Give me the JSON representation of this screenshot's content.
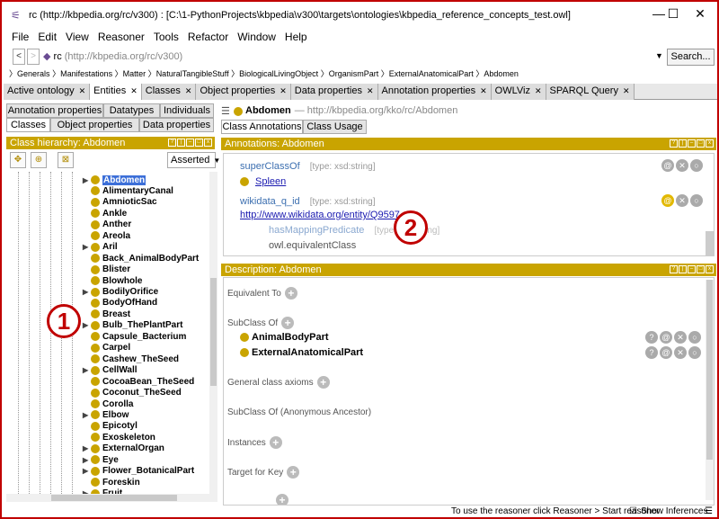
{
  "window": {
    "title": "rc (http://kbpedia.org/rc/v300)  : [C:\\1-PythonProjects\\kbpedia\\v300\\targets\\ontologies\\kbpedia_reference_concepts_test.owl]",
    "minimize": "—",
    "maximize": "☐",
    "close": "✕"
  },
  "menu": [
    "File",
    "Edit",
    "View",
    "Reasoner",
    "Tools",
    "Refactor",
    "Window",
    "Help"
  ],
  "address": {
    "back": "<",
    "forward": ">",
    "name": "rc",
    "uri": "(http://kbpedia.org/rc/v300)",
    "search_label": "Search..."
  },
  "breadcrumb": [
    "Generals",
    "Manifestations",
    "Matter",
    "NaturalTangibleStuff",
    "BiologicalLivingObject",
    "OrganismPart",
    "ExternalAnatomicalPart",
    "Abdomen"
  ],
  "tabs": [
    {
      "label": "Active ontology",
      "active": false
    },
    {
      "label": "Entities",
      "active": true
    },
    {
      "label": "Classes",
      "active": false
    },
    {
      "label": "Object properties",
      "active": false
    },
    {
      "label": "Data properties",
      "active": false
    },
    {
      "label": "Annotation properties",
      "active": false
    },
    {
      "label": "OWLViz",
      "active": false
    },
    {
      "label": "SPARQL Query",
      "active": false
    }
  ],
  "left": {
    "subtabs_row1": [
      "Annotation properties",
      "Datatypes",
      "Individuals"
    ],
    "subtabs_row2": [
      "Classes",
      "Object properties",
      "Data properties"
    ],
    "hierarchy_title": "Class hierarchy: Abdomen",
    "asserted": "Asserted",
    "tree": [
      {
        "label": "Abdomen",
        "expandable": true,
        "selected": true
      },
      {
        "label": "AlimentaryCanal",
        "expandable": false
      },
      {
        "label": "AmnioticSac",
        "expandable": false
      },
      {
        "label": "Ankle",
        "expandable": false
      },
      {
        "label": "Anther",
        "expandable": false
      },
      {
        "label": "Areola",
        "expandable": false
      },
      {
        "label": "Aril",
        "expandable": true
      },
      {
        "label": "Back_AnimalBodyPart",
        "expandable": false
      },
      {
        "label": "Blister",
        "expandable": false
      },
      {
        "label": "Blowhole",
        "expandable": false
      },
      {
        "label": "BodilyOrifice",
        "expandable": true
      },
      {
        "label": "BodyOfHand",
        "expandable": false
      },
      {
        "label": "Breast",
        "expandable": false
      },
      {
        "label": "Bulb_ThePlantPart",
        "expandable": true
      },
      {
        "label": "Capsule_Bacterium",
        "expandable": false
      },
      {
        "label": "Carpel",
        "expandable": false
      },
      {
        "label": "Cashew_TheSeed",
        "expandable": false
      },
      {
        "label": "CellWall",
        "expandable": true
      },
      {
        "label": "CocoaBean_TheSeed",
        "expandable": false
      },
      {
        "label": "Coconut_TheSeed",
        "expandable": false
      },
      {
        "label": "Corolla",
        "expandable": false
      },
      {
        "label": "Elbow",
        "expandable": true
      },
      {
        "label": "Epicotyl",
        "expandable": false
      },
      {
        "label": "Exoskeleton",
        "expandable": false
      },
      {
        "label": "ExternalOrgan",
        "expandable": true
      },
      {
        "label": "Eye",
        "expandable": true
      },
      {
        "label": "Flower_BotanicalPart",
        "expandable": true
      },
      {
        "label": "Foreskin",
        "expandable": false
      },
      {
        "label": "Fruit",
        "expandable": true
      }
    ]
  },
  "right": {
    "entity_name": "Abdomen",
    "entity_uri": "— http://kbpedia.org/kko/rc/Abdomen",
    "subtabs": [
      "Class Annotations",
      "Class Usage"
    ],
    "annotations_title": "Annotations: Abdomen",
    "annotations": [
      {
        "property": "superClassOf",
        "type": "[type: xsd:string]",
        "value": "Spleen"
      },
      {
        "property": "wikidata_q_id",
        "type": "[type: xsd:string]",
        "value": "http://www.wikidata.org/entity/Q9597",
        "sub_property": "hasMappingPredicate",
        "sub_type": "[type: xsd:string]",
        "sub_value": "owl.equivalentClass"
      }
    ],
    "description_title": "Description: Abdomen",
    "sections": [
      {
        "label": "Equivalent To",
        "items": []
      },
      {
        "label": "SubClass Of",
        "items": [
          "AnimalBodyPart",
          "ExternalAnatomicalPart"
        ]
      },
      {
        "label": "General class axioms",
        "items": []
      },
      {
        "label": "SubClass Of (Anonymous Ancestor)",
        "items": []
      },
      {
        "label": "Instances",
        "items": []
      },
      {
        "label": "Target for Key",
        "items": []
      }
    ]
  },
  "status": {
    "hint": "To use the reasoner click Reasoner > Start reasoner",
    "show_inferences": "Show Inferences"
  },
  "callouts": [
    "1",
    "2"
  ],
  "colors": {
    "accent_gold": "#c9a400",
    "selection": "#3c6fd8",
    "callout_red": "#c00000"
  }
}
